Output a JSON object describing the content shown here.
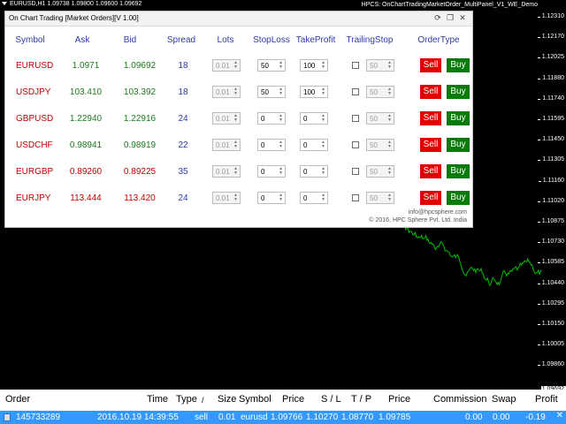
{
  "chart": {
    "symbol_line": "EURUSD,H1  1.09738 1.09800 1.09600 1.09692",
    "window_title": "HPCS: OnChartTradingMarketOrder_MultiPanel_V1_WE_Demo",
    "price_ticks": [
      "1.12310",
      "1.12170",
      "1.12025",
      "1.11880",
      "1.11740",
      "1.11595",
      "1.11450",
      "1.11305",
      "1.11160",
      "1.11020",
      "1.10875",
      "1.10730",
      "1.10585",
      "1.10440",
      "1.10295",
      "1.10150",
      "1.10005",
      "1.09860"
    ],
    "current_price": "1.09692",
    "line_color": "#00c000"
  },
  "panel": {
    "title": "On Chart Trading [Market Orders][V 1.00]",
    "icons": [
      "refresh-icon",
      "copy-icon",
      "close-icon"
    ],
    "headers": {
      "symbol": "Symbol",
      "ask": "Ask",
      "bid": "Bid",
      "spread": "Spread",
      "lots": "Lots",
      "stoploss": "StopLoss",
      "takeprofit": "TakeProfit",
      "trailingstop": "TrailingStop",
      "ordertype": "OrderType"
    },
    "rows": [
      {
        "symbol": "EURUSD",
        "ask": "1.0971",
        "bid": "1.09692",
        "spread": "18",
        "lots": "0.01",
        "stoploss": "50",
        "takeprofit": "100",
        "trailing": "50",
        "sell": "Sell",
        "buy": "Buy"
      },
      {
        "symbol": "USDJPY",
        "ask": "103.410",
        "bid": "103.392",
        "spread": "18",
        "lots": "0.01",
        "stoploss": "50",
        "takeprofit": "100",
        "trailing": "50",
        "sell": "Sell",
        "buy": "Buy"
      },
      {
        "symbol": "GBPUSD",
        "ask": "1.22940",
        "bid": "1.22916",
        "spread": "24",
        "lots": "0.01",
        "stoploss": "0",
        "takeprofit": "0",
        "trailing": "50",
        "sell": "Sell",
        "buy": "Buy"
      },
      {
        "symbol": "USDCHF",
        "ask": "0.98941",
        "bid": "0.98919",
        "spread": "22",
        "lots": "0.01",
        "stoploss": "0",
        "takeprofit": "0",
        "trailing": "50",
        "sell": "Sell",
        "buy": "Buy"
      },
      {
        "symbol": "EURGBP",
        "ask": "0.89260",
        "bid": "0.89225",
        "spread": "35",
        "lots": "0.01",
        "stoploss": "0",
        "takeprofit": "0",
        "trailing": "50",
        "sell": "Sell",
        "buy": "Buy"
      },
      {
        "symbol": "EURJPY",
        "ask": "113.444",
        "bid": "113.420",
        "spread": "24",
        "lots": "0.01",
        "stoploss": "0",
        "takeprofit": "0",
        "trailing": "50",
        "sell": "Sell",
        "buy": "Buy"
      }
    ],
    "footer_email": "info@hpcsphere.com",
    "footer_copyright": "© 2016, HPC Sphere Pvt. Ltd. India"
  },
  "terminal": {
    "headers": {
      "order": "Order",
      "time": "Time",
      "type": "Type",
      "sort": "/",
      "size": "Size",
      "symbol": "Symbol",
      "price": "Price",
      "sl": "S / L",
      "tp": "T / P",
      "price2": "Price",
      "commission": "Commission",
      "swap": "Swap",
      "profit": "Profit"
    },
    "row": {
      "order": "145733289",
      "time": "2016.10.19 14:39:55",
      "type": "sell",
      "size": "0.01",
      "symbol": "eurusd",
      "price": "1.09766",
      "sl": "1.10270",
      "tp": "1.08770",
      "price2": "1.09785",
      "commission": "0.00",
      "swap": "0.00",
      "profit": "-0.19"
    }
  },
  "colors": {
    "header_blue": "#2c3aa8",
    "sell_red": "#e00000",
    "buy_green": "#0a7a0a",
    "selected_row": "#3399ff"
  }
}
